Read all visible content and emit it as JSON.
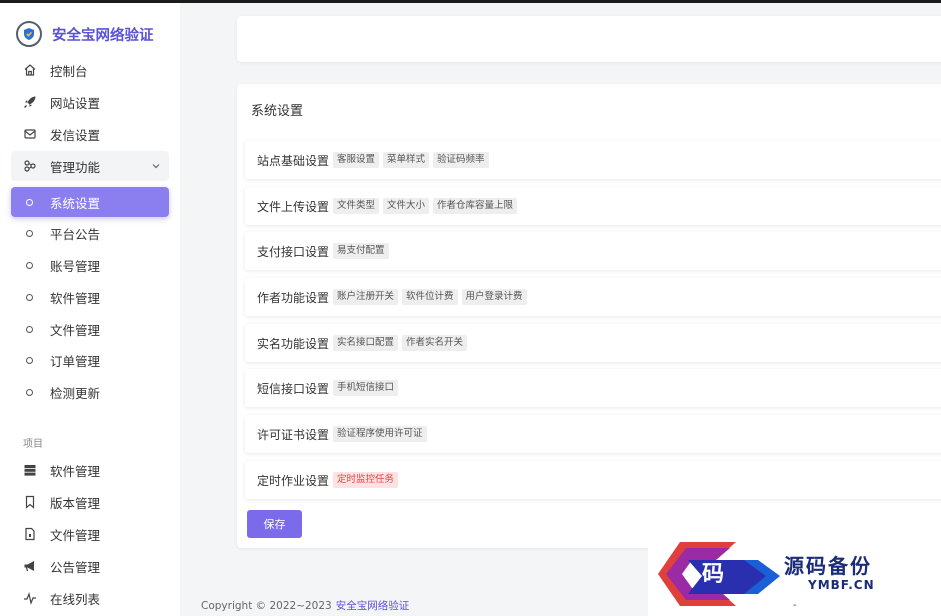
{
  "brand": {
    "name": "安全宝网络验证"
  },
  "sidebar": {
    "items": [
      {
        "label": "控制台",
        "icon": "home-icon"
      },
      {
        "label": "网站设置",
        "icon": "rocket-icon"
      },
      {
        "label": "发信设置",
        "icon": "mail-icon"
      },
      {
        "label": "管理功能",
        "icon": "cluster-icon"
      }
    ],
    "submenu": [
      {
        "label": "系统设置",
        "active": true
      },
      {
        "label": "平台公告"
      },
      {
        "label": "账号管理"
      },
      {
        "label": "软件管理"
      },
      {
        "label": "文件管理"
      },
      {
        "label": "订单管理"
      },
      {
        "label": "检测更新"
      }
    ],
    "section_title": "项目",
    "project_items": [
      {
        "label": "软件管理",
        "icon": "server-icon"
      },
      {
        "label": "版本管理",
        "icon": "bookmark-icon"
      },
      {
        "label": "文件管理",
        "icon": "file-icon"
      },
      {
        "label": "公告管理",
        "icon": "megaphone-icon"
      },
      {
        "label": "在线列表",
        "icon": "pulse-icon"
      }
    ]
  },
  "main": {
    "title": "系统设置",
    "rows": [
      {
        "label": "站点基础设置",
        "tags": [
          "客服设置",
          "菜单样式",
          "验证码频率"
        ]
      },
      {
        "label": "文件上传设置",
        "tags": [
          "文件类型",
          "文件大小",
          "作者仓库容量上限"
        ]
      },
      {
        "label": "支付接口设置",
        "tags": [
          "易支付配置"
        ]
      },
      {
        "label": "作者功能设置",
        "tags": [
          "账户注册开关",
          "软件位计费",
          "用户登录计费"
        ]
      },
      {
        "label": "实名功能设置",
        "tags": [
          "实名接口配置",
          "作者实名开关"
        ]
      },
      {
        "label": "短信接口设置",
        "tags": [
          "手机短信接口"
        ]
      },
      {
        "label": "许可证书设置",
        "tags": [
          "验证程序使用许可证"
        ]
      },
      {
        "label": "定时作业设置",
        "tags": [
          "定时监控任务"
        ],
        "tag_style": "danger"
      }
    ],
    "save_label": "保存"
  },
  "footer": {
    "copyright": "Copyright © 2022~2023",
    "link": "安全宝网络验证"
  },
  "watermark": {
    "char": "码",
    "title": "源码备份",
    "subtitle": "YMBF.CN",
    "dash": "-"
  },
  "colors": {
    "accent": "#7b6bea",
    "brand": "#5b52d6",
    "danger": "#e04848"
  }
}
